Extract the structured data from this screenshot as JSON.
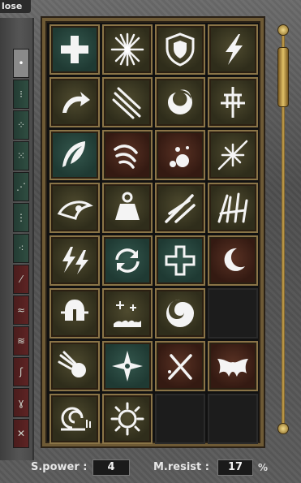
{
  "window": {
    "close_label": "lose"
  },
  "sidebar": {
    "tabs": [
      {
        "color": "light",
        "glyph": "•"
      },
      {
        "color": "green",
        "glyph": "⁝"
      },
      {
        "color": "green",
        "glyph": "⁘"
      },
      {
        "color": "green",
        "glyph": "⁙"
      },
      {
        "color": "green",
        "glyph": "⋰"
      },
      {
        "color": "green",
        "glyph": "⋮"
      },
      {
        "color": "green",
        "glyph": "⁖"
      },
      {
        "color": "red",
        "glyph": "⁄"
      },
      {
        "color": "red",
        "glyph": "≈"
      },
      {
        "color": "red",
        "glyph": "≋"
      },
      {
        "color": "red",
        "glyph": "ʃ"
      },
      {
        "color": "red",
        "glyph": "ɣ"
      },
      {
        "color": "red",
        "glyph": "✕"
      }
    ]
  },
  "skills": [
    {
      "icon": "heal-cross-icon",
      "bg": "teal"
    },
    {
      "icon": "starburst-icon",
      "bg": "olive"
    },
    {
      "icon": "shield-icon",
      "bg": "olive"
    },
    {
      "icon": "lightning-icon",
      "bg": "olive"
    },
    {
      "icon": "curved-arrow-icon",
      "bg": "olive"
    },
    {
      "icon": "triple-slash-icon",
      "bg": "olive"
    },
    {
      "icon": "vortex-icon",
      "bg": "olive"
    },
    {
      "icon": "holy-cross-icon",
      "bg": "olive"
    },
    {
      "icon": "feather-icon",
      "bg": "teal"
    },
    {
      "icon": "claw-icon",
      "bg": "brown"
    },
    {
      "icon": "bubbles-icon",
      "bg": "brown"
    },
    {
      "icon": "sparkle-slash-icon",
      "bg": "olive"
    },
    {
      "icon": "eye-icon",
      "bg": "olive"
    },
    {
      "icon": "weight-icon",
      "bg": "olive"
    },
    {
      "icon": "wind-slash-icon",
      "bg": "olive"
    },
    {
      "icon": "spikes-icon",
      "bg": "olive"
    },
    {
      "icon": "double-lightning-icon",
      "bg": "olive"
    },
    {
      "icon": "cycle-arrows-icon",
      "bg": "teal"
    },
    {
      "icon": "outline-cross-icon",
      "bg": "teal"
    },
    {
      "icon": "crescent-moon-icon",
      "bg": "brown"
    },
    {
      "icon": "helmet-icon",
      "bg": "olive"
    },
    {
      "icon": "flame-sparkle-icon",
      "bg": "olive"
    },
    {
      "icon": "swirl-icon",
      "bg": "olive"
    },
    {
      "icon": "",
      "bg": "empty"
    },
    {
      "icon": "comet-icon",
      "bg": "olive"
    },
    {
      "icon": "shuriken-icon",
      "bg": "teal"
    },
    {
      "icon": "crossed-swords-icon",
      "bg": "brown"
    },
    {
      "icon": "bat-wing-icon",
      "bg": "brown"
    },
    {
      "icon": "snail-spiral-icon",
      "bg": "olive"
    },
    {
      "icon": "spiked-sun-icon",
      "bg": "olive"
    },
    {
      "icon": "",
      "bg": "empty"
    },
    {
      "icon": "",
      "bg": "empty"
    }
  ],
  "stats": {
    "spower_label": "S.power :",
    "spower_value": "4",
    "mresist_label": "M.resist :",
    "mresist_value": "17",
    "mresist_unit": "%"
  },
  "colors": {
    "frame_gold": "#8a7447",
    "teal": "#2a4a42",
    "olive": "#3f3c24",
    "brown": "#482519"
  }
}
